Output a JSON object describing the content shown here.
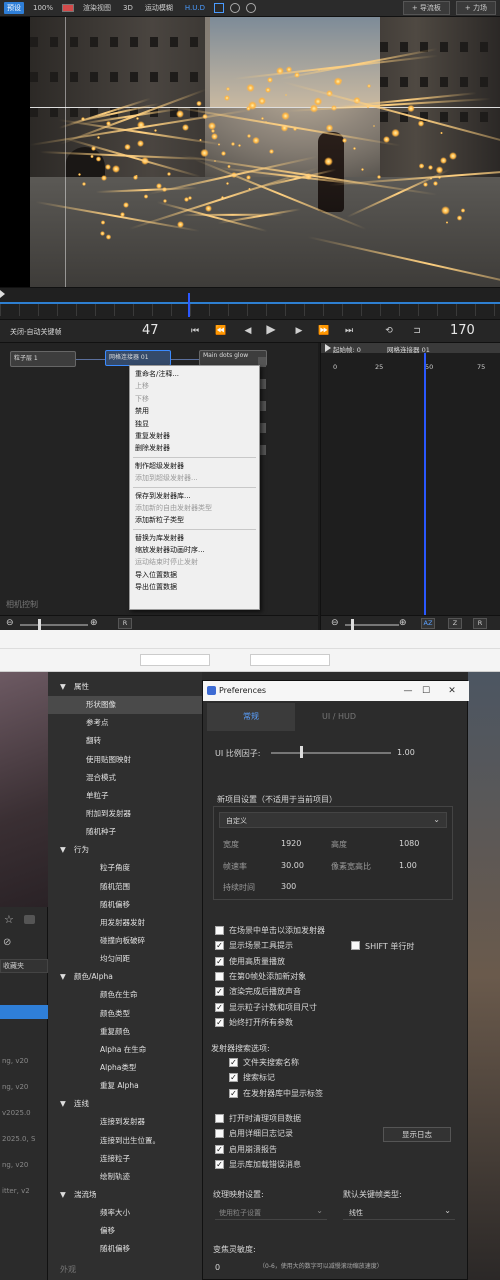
{
  "toolbar": {
    "items": [
      "预设",
      "100%",
      "渲染视图",
      "3D",
      "运动模糊",
      "H.U.D"
    ],
    "button_flow": "+ 导流板",
    "button_force": "+ 力场"
  },
  "transport": {
    "label": "关闭-自动关键帧",
    "current_frame": "47",
    "end_frame": "170"
  },
  "nodes": {
    "node1": "粒子层 1",
    "node2": "网格连接器 01",
    "node3": "Main dots glow",
    "footer": "相机控制",
    "zoom_btn": "R"
  },
  "context_menu": {
    "groups": [
      [
        {
          "t": "重命名/注释...",
          "d": false
        },
        {
          "t": "上移",
          "d": true
        },
        {
          "t": "下移",
          "d": true
        },
        {
          "t": "禁用",
          "d": false
        },
        {
          "t": "独显",
          "d": false
        },
        {
          "t": "重复发射器",
          "d": false
        },
        {
          "t": "删除发射器",
          "d": false
        }
      ],
      [
        {
          "t": "制作超级发射器",
          "d": false
        },
        {
          "t": "添加到超级发射器...",
          "d": true
        }
      ],
      [
        {
          "t": "保存到发射器库...",
          "d": false
        },
        {
          "t": "添加新的自由发射器类型",
          "d": true
        },
        {
          "t": "添加新粒子类型",
          "d": false
        }
      ],
      [
        {
          "t": "替换为库发射器",
          "d": false
        },
        {
          "t": "缩放发射器动画时序...",
          "d": false
        },
        {
          "t": "运动结束时停止发射",
          "d": true
        },
        {
          "t": "导入位置数据",
          "d": false
        },
        {
          "t": "导出位置数据",
          "d": false
        }
      ]
    ]
  },
  "timeline_right": {
    "start_label": "起始帧: 0",
    "track": "网格连接器 01",
    "scale": [
      "0",
      "25",
      "50",
      "75"
    ],
    "btn_az": "AZ",
    "btn_z": "Z",
    "btn_r": "R"
  },
  "lower_left": {
    "tab": "收藏夹",
    "lines": [
      "ng, v20",
      "ng, v20",
      "v2025.0",
      "2025.0, S",
      "ng, v20",
      "itter, v2"
    ],
    "footer": "外观"
  },
  "tree": {
    "items": [
      {
        "t": "属性",
        "level": 0,
        "caret": "▼"
      },
      {
        "t": "形状图像",
        "level": 1,
        "sel": true
      },
      {
        "t": "参考点",
        "level": 1
      },
      {
        "t": "翻转",
        "level": 1
      },
      {
        "t": "使用贴图映射",
        "level": 1
      },
      {
        "t": "混合模式",
        "level": 1
      },
      {
        "t": "单粒子",
        "level": 1
      },
      {
        "t": "附加到发射器",
        "level": 1
      },
      {
        "t": "随机种子",
        "level": 1
      },
      {
        "t": "行为",
        "level": 0,
        "caret": "▼"
      },
      {
        "t": "粒子角度",
        "level": 2
      },
      {
        "t": "随机范围",
        "level": 2
      },
      {
        "t": "随机偏移",
        "level": 2
      },
      {
        "t": "用发射器发射",
        "level": 2
      },
      {
        "t": "碰撞向板破碎",
        "level": 2
      },
      {
        "t": "均匀间距",
        "level": 2
      },
      {
        "t": "颜色/Alpha",
        "level": 0,
        "caret": "▼"
      },
      {
        "t": "颜色在生命",
        "level": 2
      },
      {
        "t": "颜色类型",
        "level": 2
      },
      {
        "t": "重复颜色",
        "level": 2
      },
      {
        "t": "Alpha 在生命",
        "level": 2
      },
      {
        "t": "Alpha类型",
        "level": 2
      },
      {
        "t": "重复 Alpha",
        "level": 2
      },
      {
        "t": "连线",
        "level": 0,
        "caret": "▼"
      },
      {
        "t": "连接到发射器",
        "level": 2
      },
      {
        "t": "连接到出生位置。",
        "level": 2
      },
      {
        "t": "连接粒子",
        "level": 2
      },
      {
        "t": "绘制轨迹",
        "level": 2
      },
      {
        "t": "湍流场",
        "level": 0,
        "caret": "▼"
      },
      {
        "t": "频率大小",
        "level": 2
      },
      {
        "t": "偏移",
        "level": 2
      },
      {
        "t": "随机偏移",
        "level": 2
      }
    ]
  },
  "prefs": {
    "title": "Preferences",
    "tabs": [
      "常规",
      "UI / HUD"
    ],
    "ui_scale_label": "UI 比例因子:",
    "ui_scale_value": "1.00",
    "ui_scale_fraction": 0.5,
    "project_section": "新项目设置（不适用于当前项目）",
    "preset": "自定义",
    "width_label": "宽度",
    "width_value": "1920",
    "height_label": "高度",
    "height_value": "1080",
    "fps_label": "帧速率",
    "fps_value": "30.00",
    "par_label": "像素宽高比",
    "par_value": "1.00",
    "duration_label": "持续时间",
    "duration_value": "300",
    "checks": [
      {
        "t": "在场景中单击以添加发射器",
        "c": false
      },
      {
        "t": "显示场景工具提示",
        "c": true
      },
      {
        "t": "使用高质量播放",
        "c": true
      },
      {
        "t": "在第0帧处添加新对象",
        "c": false
      },
      {
        "t": "渲染完成后播放声音",
        "c": true
      },
      {
        "t": "显示粒子计数和项目尺寸",
        "c": true
      },
      {
        "t": "始终打开所有参数",
        "c": true
      }
    ],
    "shift_label": "SHIFT 单行时",
    "shift_checked": false,
    "search_section": "发射器搜索选项:",
    "search_checks": [
      {
        "t": "文件夹搜索名称",
        "c": true
      },
      {
        "t": "搜索标记",
        "c": true
      },
      {
        "t": "在发射器库中显示标签",
        "c": true
      }
    ],
    "misc_checks": [
      {
        "t": "打开时清理项目数据",
        "c": false
      },
      {
        "t": "启用详细日志记录",
        "c": false
      },
      {
        "t": "启用崩溃报告",
        "c": true
      },
      {
        "t": "显示库加载错误消息",
        "c": true
      }
    ],
    "show_log": "显示日志",
    "texture_label": "纹理映射设置:",
    "texture_value": "使用粒子设置",
    "keyframe_label": "默认关键帧类型:",
    "keyframe_value": "线性",
    "sensitivity_label": "变焦灵敏度:",
    "sensitivity_value": "0",
    "sensitivity_hint": "（0-6，使用大的数字可以减慢滚动缩放速度）"
  },
  "colors": {
    "accent": "#2f7fd8",
    "cursor": "#2a58ff",
    "highlight": "#5aa0ff"
  }
}
